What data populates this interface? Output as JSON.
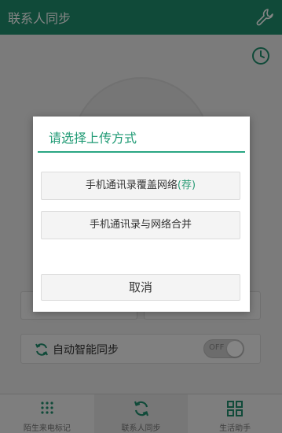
{
  "header": {
    "title": "联系人同步",
    "tool_icon": "wrench-icon"
  },
  "history_icon": "clock-icon",
  "auto_sync": {
    "label": "自动智能同步",
    "toggle_text": "OFF"
  },
  "bottom_nav": {
    "items": [
      {
        "label": "陌生来电标记",
        "icon": "grid-dots-icon"
      },
      {
        "label": "联系人同步",
        "icon": "sync-icon",
        "active": true
      },
      {
        "label": "生活助手",
        "icon": "four-squares-icon"
      }
    ]
  },
  "dialog": {
    "title": "请选择上传方式",
    "option1": {
      "label": "手机通讯录覆盖网络",
      "recommend": "(荐)"
    },
    "option2": {
      "label": "手机通讯录与网络合并"
    },
    "cancel_label": "取消"
  },
  "colors": {
    "brand": "#1f8f6d",
    "accent": "#2aa683"
  }
}
